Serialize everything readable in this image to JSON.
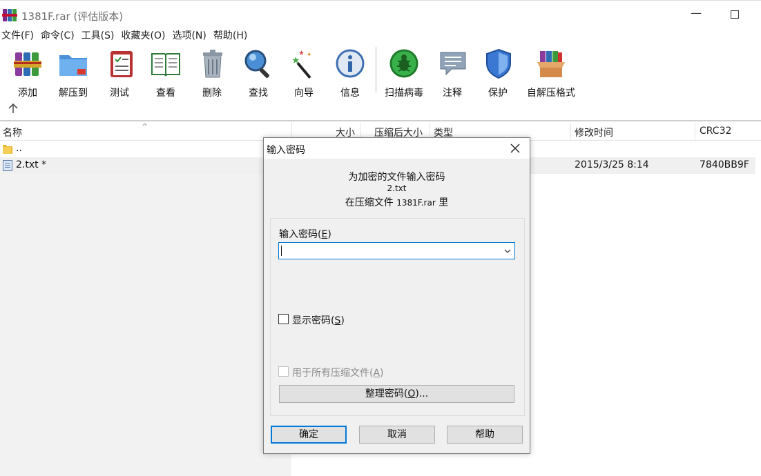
{
  "window": {
    "title": "1381F.rar (评估版本)"
  },
  "menu": [
    "文件(F)",
    "命令(C)",
    "工具(S)",
    "收藏夹(O)",
    "选项(N)",
    "帮助(H)"
  ],
  "toolbar": {
    "buttons": [
      {
        "label": "添加",
        "icon": "add-books-icon"
      },
      {
        "label": "解压到",
        "icon": "extract-folder-icon"
      },
      {
        "label": "测试",
        "icon": "test-clipboard-icon"
      },
      {
        "label": "查看",
        "icon": "view-book-icon"
      },
      {
        "label": "删除",
        "icon": "trash-icon"
      },
      {
        "label": "查找",
        "icon": "magnifier-icon"
      },
      {
        "label": "向导",
        "icon": "wizard-wand-icon"
      },
      {
        "label": "信息",
        "icon": "info-icon"
      },
      {
        "label": "扫描病毒",
        "icon": "virus-scan-icon"
      },
      {
        "label": "注释",
        "icon": "comment-icon"
      },
      {
        "label": "保护",
        "icon": "shield-icon"
      },
      {
        "label": "自解压格式",
        "icon": "sfx-box-icon"
      }
    ]
  },
  "file_list": {
    "columns": [
      "名称",
      "大小",
      "压缩后大小",
      "类型",
      "修改时间",
      "CRC32"
    ],
    "rows": [
      {
        "name": "..",
        "icon": "folder-icon",
        "modified": "",
        "crc": ""
      },
      {
        "name": "2.txt *",
        "icon": "text-file-icon",
        "modified": "2015/3/25 8:14",
        "crc": "7840BB9F"
      }
    ]
  },
  "dialog": {
    "title": "输入密码",
    "message_line1": "为加密的文件输入密码",
    "file_name": "2.txt",
    "message_line3_prefix": "在压缩文件",
    "archive_name": "1381F.rar",
    "message_line3_suffix": "里",
    "password_label": "输入密码",
    "password_hotkey": "E",
    "password_value": "",
    "show_password_label": "显示密码",
    "show_password_hotkey": "S",
    "show_password_checked": false,
    "all_archives_label": "用于所有压缩文件",
    "all_archives_hotkey": "A",
    "all_archives_enabled": false,
    "organize_label": "整理密码",
    "organize_hotkey": "O",
    "buttons": {
      "ok": "确定",
      "cancel": "取消",
      "help": "帮助"
    }
  },
  "colors": {
    "accent": "#0078d7",
    "dialog_bg": "#f0f0f0",
    "button_bg": "#e1e1e1"
  }
}
